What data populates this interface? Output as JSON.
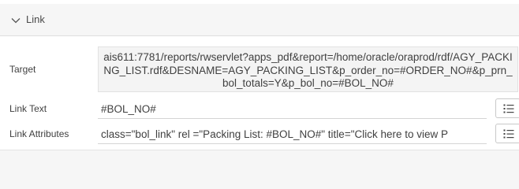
{
  "section": {
    "title": "Link",
    "expanded": true
  },
  "fields": {
    "target": {
      "label": "Target",
      "value": "ais611:7781/reports/rwservlet?apps_pdf&report=/home/oracle/oraprod/rdf/AGY_PACKING_LIST.rdf&DESNAME=AGY_PACKING_LIST&p_order_no=#ORDER_NO#&p_prn_bol_totals=Y&p_bol_no=#BOL_NO#"
    },
    "link_text": {
      "label": "Link Text",
      "value": "#BOL_NO#"
    },
    "link_attributes": {
      "label": "Link Attributes",
      "value": "class=\"bol_link\" rel =\"Packing List: #BOL_NO#\" title=\"Click here to view P"
    }
  },
  "icons": {
    "collapse": "chevron-down-icon",
    "list": "list-icon"
  },
  "colors": {
    "background": "#f6f6f6",
    "text": "#404040",
    "target_box": "#f4f4f4"
  }
}
